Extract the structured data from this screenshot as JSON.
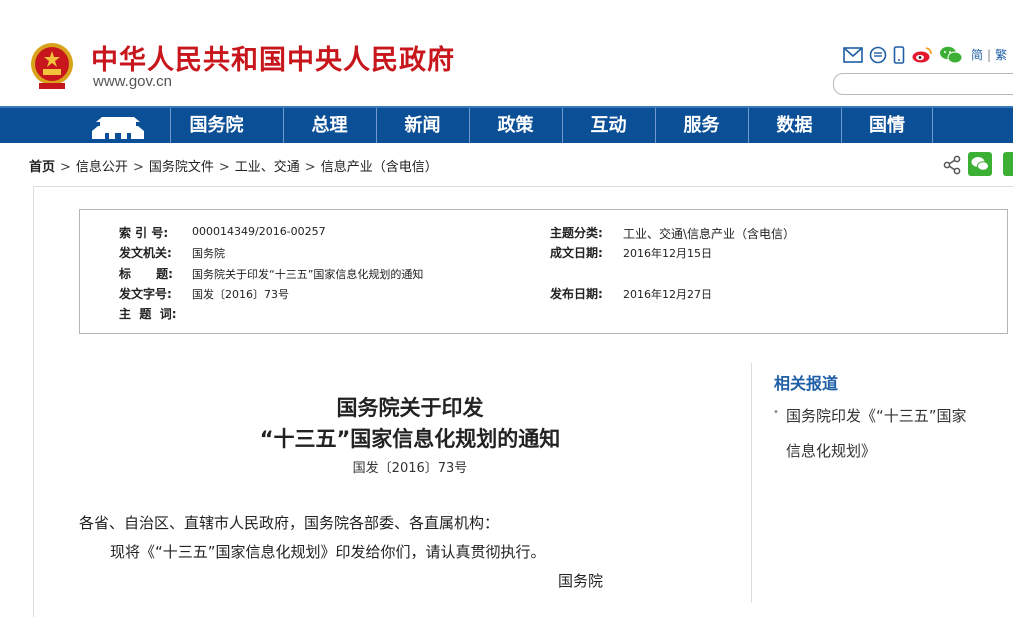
{
  "header": {
    "site_title": "中华人民共和国中央人民政府",
    "site_domain": "www.gov.cn",
    "lang_simplified": "简",
    "lang_separator": "|",
    "lang_traditional": "繁"
  },
  "nav": {
    "items": [
      {
        "label": "国务院"
      },
      {
        "label": "总理"
      },
      {
        "label": "新闻"
      },
      {
        "label": "政策"
      },
      {
        "label": "互动"
      },
      {
        "label": "服务"
      },
      {
        "label": "数据"
      },
      {
        "label": "国情"
      }
    ]
  },
  "breadcrumb": {
    "home": "首页",
    "sep": ">",
    "items": [
      "信息公开",
      "国务院文件",
      "工业、交通",
      "信息产业（含电信）"
    ]
  },
  "info": {
    "index_label": "索  引  号:",
    "index_value": "000014349/2016-00257",
    "topic_label": "主题分类:",
    "topic_value": "工业、交通\\信息产业（含电信）",
    "issuer_label": "发文机关:",
    "issuer_value": "国务院",
    "date_created_label": "成文日期:",
    "date_created_value": "2016年12月15日",
    "title_label": "标      题:",
    "title_value": "国务院关于印发“十三五”国家信息化规划的通知",
    "doc_no_label": "发文字号:",
    "doc_no_value": "国发〔2016〕73号",
    "publish_label": "发布日期:",
    "publish_value": "2016年12月27日",
    "keywords_label": "主  题  词:"
  },
  "document": {
    "title_line1": "国务院关于印发",
    "title_line2": "“十三五”国家信息化规划的通知",
    "number": "国发〔2016〕73号",
    "para1": "各省、自治区、直辖市人民政府，国务院各部委、各直属机构：",
    "para2": "现将《“十三五”国家信息化规划》印发给你们，请认真贯彻执行。",
    "signer": "国务院"
  },
  "related": {
    "title": "相关报道",
    "bullet": "•",
    "link_line1": "国务院印发《“十三五”国家",
    "link_line2": "信息化规划》"
  },
  "colors": {
    "brand_red": "#c8161d",
    "nav_blue": "#0b4f97",
    "link_blue": "#1f5fa5",
    "wechat_green": "#3cb034"
  }
}
